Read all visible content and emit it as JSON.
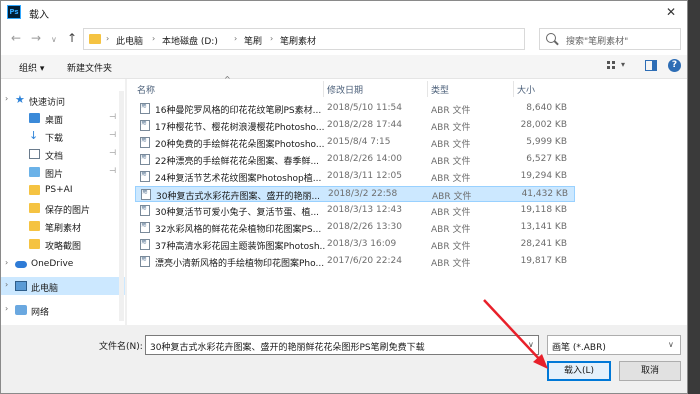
{
  "dialog": {
    "title": "载入",
    "app_logo": "Ps"
  },
  "address": {
    "breadcrumbs": [
      "此电脑",
      "本地磁盘 (D:)",
      "笔刷",
      "笔刷素材"
    ],
    "search_placeholder": "搜索\"笔刷素材\""
  },
  "toolbar": {
    "organize": "组织 ▾",
    "new_folder": "新建文件夹"
  },
  "sidebar": {
    "items": [
      {
        "label": "快速访问",
        "icon": "star-icon",
        "pinned": false
      },
      {
        "label": "桌面",
        "icon": "desktop-icon",
        "pinned": true
      },
      {
        "label": "下载",
        "icon": "download-icon",
        "pinned": true
      },
      {
        "label": "文档",
        "icon": "document-icon",
        "pinned": true
      },
      {
        "label": "图片",
        "icon": "picture-icon",
        "pinned": true
      },
      {
        "label": "PS+AI",
        "icon": "folder-icon",
        "pinned": false
      },
      {
        "label": "保存的图片",
        "icon": "folder-icon",
        "pinned": false
      },
      {
        "label": "笔刷素材",
        "icon": "folder-icon",
        "pinned": false
      },
      {
        "label": "攻略截图",
        "icon": "folder-icon",
        "pinned": false
      },
      {
        "label": "OneDrive",
        "icon": "cloud-icon",
        "pinned": false
      },
      {
        "label": "此电脑",
        "icon": "computer-icon",
        "pinned": false
      },
      {
        "label": "网络",
        "icon": "network-icon",
        "pinned": false
      }
    ]
  },
  "columns": {
    "name": "名称",
    "modified": "修改日期",
    "type": "类型",
    "size": "大小"
  },
  "files": [
    {
      "name": "16种曼陀罗风格的印花花纹笔刷PS素材...",
      "date": "2018/5/10 11:54",
      "type": "ABR 文件",
      "size": "8,640 KB"
    },
    {
      "name": "17种樱花节、樱花树浪漫樱花Photosho...",
      "date": "2018/2/28 17:44",
      "type": "ABR 文件",
      "size": "28,002 KB"
    },
    {
      "name": "20种免费的手绘鲜花花朵图案Photosho...",
      "date": "2015/8/4 7:15",
      "type": "ABR 文件",
      "size": "5,999 KB"
    },
    {
      "name": "22种漂亮的手绘鲜花花朵图案、春季鲜...",
      "date": "2018/2/26 14:00",
      "type": "ABR 文件",
      "size": "6,527 KB"
    },
    {
      "name": "24种复活节艺术花纹图案Photoshop植...",
      "date": "2018/3/11 12:05",
      "type": "ABR 文件",
      "size": "19,294 KB"
    },
    {
      "name": "30种复古式水彩花卉图案、盛开的艳丽...",
      "date": "2018/3/2 22:58",
      "type": "ABR 文件",
      "size": "41,432 KB",
      "selected": true
    },
    {
      "name": "30种复活节可爱小兔子、复活节蛋、植...",
      "date": "2018/3/13 12:43",
      "type": "ABR 文件",
      "size": "19,118 KB"
    },
    {
      "name": "32水彩风格的鲜花花朵植物印花图案PS...",
      "date": "2018/2/26 13:30",
      "type": "ABR 文件",
      "size": "13,141 KB"
    },
    {
      "name": "37种高清水彩花园主题装饰图案Photosh...",
      "date": "2018/3/3 16:09",
      "type": "ABR 文件",
      "size": "28,241 KB"
    },
    {
      "name": "漂亮小清新风格的手绘植物印花图案Pho...",
      "date": "2017/6/20 22:24",
      "type": "ABR 文件",
      "size": "19,817 KB"
    }
  ],
  "footer": {
    "filename_label": "文件名(N):",
    "filename_value": "30种复古式水彩花卉图案、盛开的艳丽鲜花花朵图形PS笔刷免费下载",
    "filetype_value": "画笔 (*.ABR)",
    "load_button": "载入(L)",
    "cancel_button": "取消"
  },
  "colors": {
    "accent": "#0078d7",
    "selection": "#cce8ff",
    "arrow": "#e8202a"
  }
}
